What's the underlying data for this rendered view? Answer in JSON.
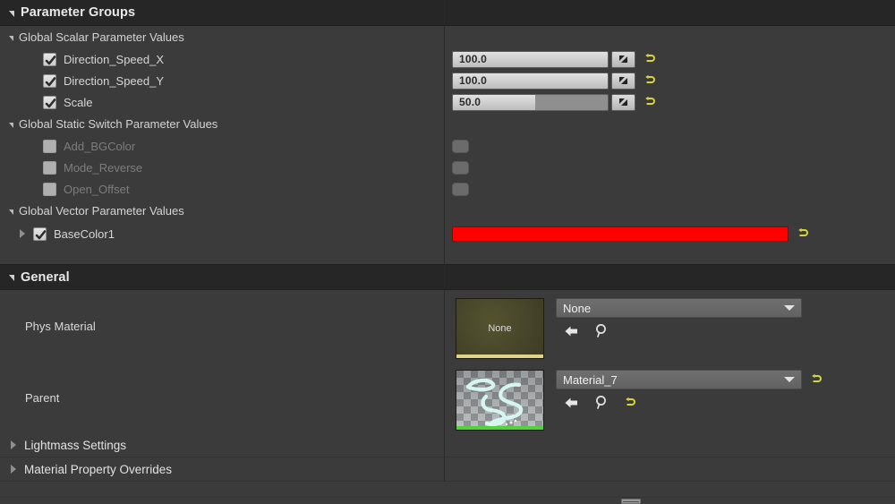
{
  "theme": {
    "panel_bg": "#3b3b3b",
    "header_bg": "#262626",
    "accent_reset": "#d8d33a",
    "base_color_swatch": "#fe0000",
    "phys_thumb_accent": "#ded389",
    "parent_thumb_accent": "#54d23a"
  },
  "sections": {
    "parameter_groups": {
      "title": "Parameter Groups",
      "groups": [
        {
          "label": "Global Scalar Parameter Values",
          "params": [
            {
              "label": "Direction_Speed_X",
              "checked": true,
              "value": "100.0",
              "fill_percent": 100,
              "reset": true
            },
            {
              "label": "Direction_Speed_Y",
              "checked": true,
              "value": "100.0",
              "fill_percent": 100,
              "reset": true
            },
            {
              "label": "Scale",
              "checked": true,
              "value": "50.0",
              "fill_percent": 53,
              "reset": true
            }
          ]
        },
        {
          "label": "Global Static Switch Parameter Values",
          "params": [
            {
              "label": "Add_BGColor",
              "checked": false,
              "disabled": true
            },
            {
              "label": "Mode_Reverse",
              "checked": false,
              "disabled": true
            },
            {
              "label": "Open_Offset",
              "checked": false,
              "disabled": true
            }
          ]
        },
        {
          "label": "Global Vector Parameter Values",
          "params": [
            {
              "label": "BaseColor1",
              "checked": true,
              "color": "#fe0000",
              "reset": true,
              "expandable": true
            }
          ]
        }
      ]
    },
    "general": {
      "title": "General",
      "rows": [
        {
          "label": "Phys Material",
          "thumbnail_text": "None",
          "thumbnail_kind": "none-olive",
          "combo_value": "None",
          "icons": [
            "use-selected-asset-icon",
            "browse-to-asset-icon"
          ],
          "reset": false
        },
        {
          "label": "Parent",
          "thumbnail_text": "",
          "thumbnail_kind": "material-preview",
          "combo_value": "Material_7",
          "icons": [
            "use-selected-asset-icon",
            "browse-to-asset-icon",
            "reset-to-default-icon"
          ],
          "reset": true
        }
      ]
    },
    "collapsed": [
      {
        "title": "Lightmass Settings"
      },
      {
        "title": "Material Property Overrides"
      }
    ]
  }
}
